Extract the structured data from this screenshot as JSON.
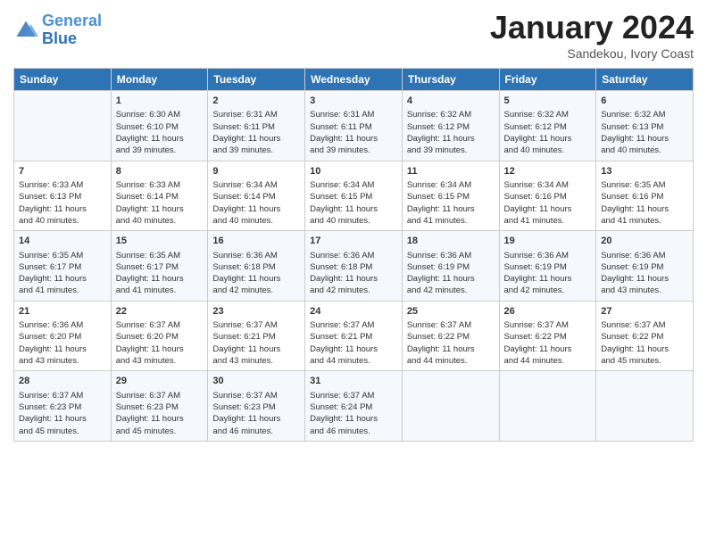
{
  "header": {
    "logo_line1": "General",
    "logo_line2": "Blue",
    "month": "January 2024",
    "location": "Sandekou, Ivory Coast"
  },
  "weekdays": [
    "Sunday",
    "Monday",
    "Tuesday",
    "Wednesday",
    "Thursday",
    "Friday",
    "Saturday"
  ],
  "weeks": [
    [
      {
        "day": "",
        "info": ""
      },
      {
        "day": "1",
        "info": "Sunrise: 6:30 AM\nSunset: 6:10 PM\nDaylight: 11 hours\nand 39 minutes."
      },
      {
        "day": "2",
        "info": "Sunrise: 6:31 AM\nSunset: 6:11 PM\nDaylight: 11 hours\nand 39 minutes."
      },
      {
        "day": "3",
        "info": "Sunrise: 6:31 AM\nSunset: 6:11 PM\nDaylight: 11 hours\nand 39 minutes."
      },
      {
        "day": "4",
        "info": "Sunrise: 6:32 AM\nSunset: 6:12 PM\nDaylight: 11 hours\nand 39 minutes."
      },
      {
        "day": "5",
        "info": "Sunrise: 6:32 AM\nSunset: 6:12 PM\nDaylight: 11 hours\nand 40 minutes."
      },
      {
        "day": "6",
        "info": "Sunrise: 6:32 AM\nSunset: 6:13 PM\nDaylight: 11 hours\nand 40 minutes."
      }
    ],
    [
      {
        "day": "7",
        "info": "Sunrise: 6:33 AM\nSunset: 6:13 PM\nDaylight: 11 hours\nand 40 minutes."
      },
      {
        "day": "8",
        "info": "Sunrise: 6:33 AM\nSunset: 6:14 PM\nDaylight: 11 hours\nand 40 minutes."
      },
      {
        "day": "9",
        "info": "Sunrise: 6:34 AM\nSunset: 6:14 PM\nDaylight: 11 hours\nand 40 minutes."
      },
      {
        "day": "10",
        "info": "Sunrise: 6:34 AM\nSunset: 6:15 PM\nDaylight: 11 hours\nand 40 minutes."
      },
      {
        "day": "11",
        "info": "Sunrise: 6:34 AM\nSunset: 6:15 PM\nDaylight: 11 hours\nand 41 minutes."
      },
      {
        "day": "12",
        "info": "Sunrise: 6:34 AM\nSunset: 6:16 PM\nDaylight: 11 hours\nand 41 minutes."
      },
      {
        "day": "13",
        "info": "Sunrise: 6:35 AM\nSunset: 6:16 PM\nDaylight: 11 hours\nand 41 minutes."
      }
    ],
    [
      {
        "day": "14",
        "info": "Sunrise: 6:35 AM\nSunset: 6:17 PM\nDaylight: 11 hours\nand 41 minutes."
      },
      {
        "day": "15",
        "info": "Sunrise: 6:35 AM\nSunset: 6:17 PM\nDaylight: 11 hours\nand 41 minutes."
      },
      {
        "day": "16",
        "info": "Sunrise: 6:36 AM\nSunset: 6:18 PM\nDaylight: 11 hours\nand 42 minutes."
      },
      {
        "day": "17",
        "info": "Sunrise: 6:36 AM\nSunset: 6:18 PM\nDaylight: 11 hours\nand 42 minutes."
      },
      {
        "day": "18",
        "info": "Sunrise: 6:36 AM\nSunset: 6:19 PM\nDaylight: 11 hours\nand 42 minutes."
      },
      {
        "day": "19",
        "info": "Sunrise: 6:36 AM\nSunset: 6:19 PM\nDaylight: 11 hours\nand 42 minutes."
      },
      {
        "day": "20",
        "info": "Sunrise: 6:36 AM\nSunset: 6:19 PM\nDaylight: 11 hours\nand 43 minutes."
      }
    ],
    [
      {
        "day": "21",
        "info": "Sunrise: 6:36 AM\nSunset: 6:20 PM\nDaylight: 11 hours\nand 43 minutes."
      },
      {
        "day": "22",
        "info": "Sunrise: 6:37 AM\nSunset: 6:20 PM\nDaylight: 11 hours\nand 43 minutes."
      },
      {
        "day": "23",
        "info": "Sunrise: 6:37 AM\nSunset: 6:21 PM\nDaylight: 11 hours\nand 43 minutes."
      },
      {
        "day": "24",
        "info": "Sunrise: 6:37 AM\nSunset: 6:21 PM\nDaylight: 11 hours\nand 44 minutes."
      },
      {
        "day": "25",
        "info": "Sunrise: 6:37 AM\nSunset: 6:22 PM\nDaylight: 11 hours\nand 44 minutes."
      },
      {
        "day": "26",
        "info": "Sunrise: 6:37 AM\nSunset: 6:22 PM\nDaylight: 11 hours\nand 44 minutes."
      },
      {
        "day": "27",
        "info": "Sunrise: 6:37 AM\nSunset: 6:22 PM\nDaylight: 11 hours\nand 45 minutes."
      }
    ],
    [
      {
        "day": "28",
        "info": "Sunrise: 6:37 AM\nSunset: 6:23 PM\nDaylight: 11 hours\nand 45 minutes."
      },
      {
        "day": "29",
        "info": "Sunrise: 6:37 AM\nSunset: 6:23 PM\nDaylight: 11 hours\nand 45 minutes."
      },
      {
        "day": "30",
        "info": "Sunrise: 6:37 AM\nSunset: 6:23 PM\nDaylight: 11 hours\nand 46 minutes."
      },
      {
        "day": "31",
        "info": "Sunrise: 6:37 AM\nSunset: 6:24 PM\nDaylight: 11 hours\nand 46 minutes."
      },
      {
        "day": "",
        "info": ""
      },
      {
        "day": "",
        "info": ""
      },
      {
        "day": "",
        "info": ""
      }
    ]
  ]
}
